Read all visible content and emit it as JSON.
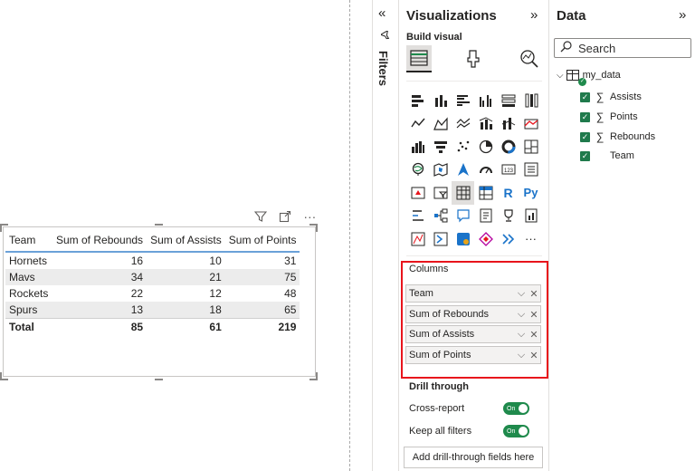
{
  "table": {
    "headers": [
      "Team",
      "Sum of Rebounds",
      "Sum of Assists",
      "Sum of Points"
    ],
    "rows": [
      [
        "Hornets",
        "16",
        "10",
        "31"
      ],
      [
        "Mavs",
        "34",
        "21",
        "75"
      ],
      [
        "Rockets",
        "22",
        "12",
        "48"
      ],
      [
        "Spurs",
        "13",
        "18",
        "65"
      ]
    ],
    "total": [
      "Total",
      "85",
      "61",
      "219"
    ]
  },
  "filters": {
    "label": "Filters"
  },
  "visualizations": {
    "title": "Visualizations",
    "build_label": "Build visual",
    "columns_label": "Columns",
    "wells": [
      "Team",
      "Sum of Rebounds",
      "Sum of Assists",
      "Sum of Points"
    ],
    "drill_through": {
      "title": "Drill through",
      "cross_report": "Cross-report",
      "keep_all_filters": "Keep all filters",
      "toggle_on": "On",
      "add_button": "Add drill-through fields here"
    },
    "r_icon": "R",
    "py_icon": "Py",
    "more": "···"
  },
  "data": {
    "title": "Data",
    "search_placeholder": "Search",
    "table_name": "my_data",
    "fields": [
      "Assists",
      "Points",
      "Rebounds",
      "Team"
    ]
  },
  "colors": {
    "accent_green": "#1f8a4c",
    "highlight_red": "#e8141c",
    "header_underline": "#6aa1d8"
  }
}
